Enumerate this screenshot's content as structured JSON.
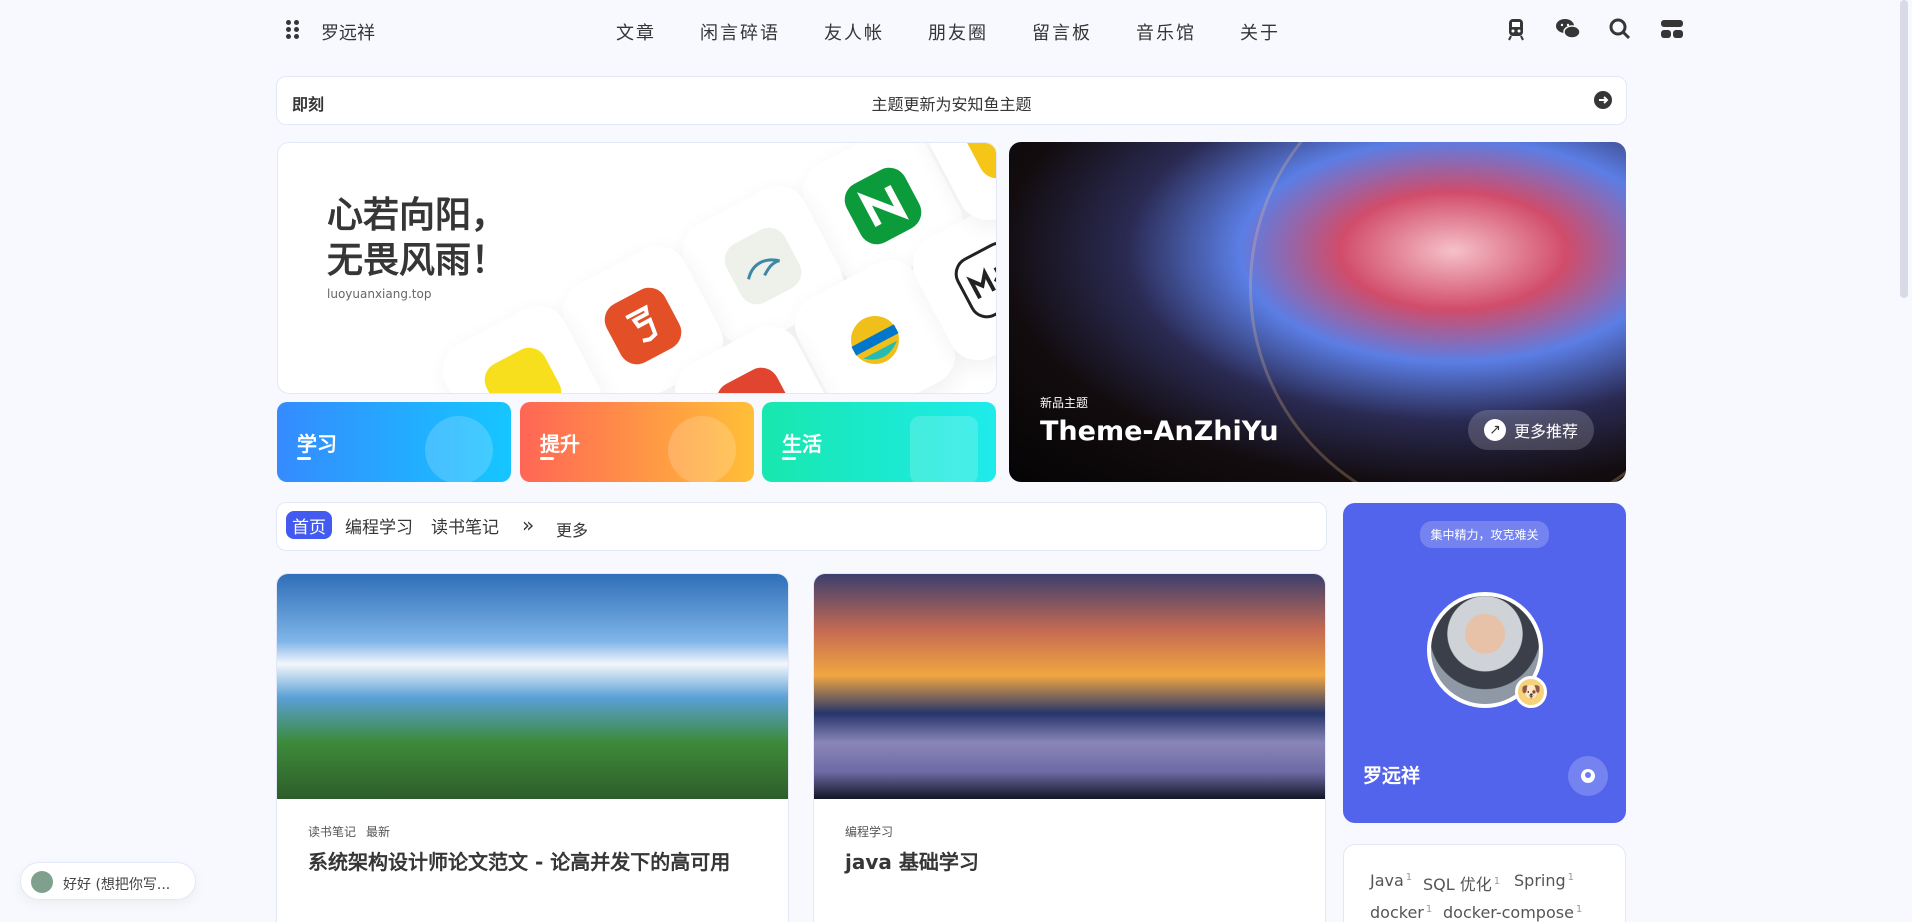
{
  "header": {
    "site_name": "罗远祥",
    "nav": [
      "文章",
      "闲言碎语",
      "友人帐",
      "朋友圈",
      "留言板",
      "音乐馆",
      "关于"
    ],
    "icons": [
      "train-icon",
      "wechat-icon",
      "search-icon",
      "switch-icon"
    ]
  },
  "notice": {
    "label": "即刻",
    "text": "主题更新为安知鱼主题"
  },
  "hero": {
    "title": "心若向阳，\n无畏风雨！",
    "url": "luoyuanxiang.top"
  },
  "categories": [
    {
      "label": "学习",
      "color_start": "#358bff",
      "color_end": "#15c6ff"
    },
    {
      "label": "提升",
      "color_start": "#f65",
      "color_end": "#ffbf37"
    },
    {
      "label": "生活",
      "color_start": "#18e7ae",
      "color_end": "#1eebeb"
    }
  ],
  "feature": {
    "badge": "新品主题",
    "title": "Theme-AnZhiYu",
    "more": "更多推荐"
  },
  "tabs": {
    "items": [
      "首页",
      "编程学习",
      "读书笔记"
    ],
    "more": "更多"
  },
  "posts": [
    {
      "tags": [
        "读书笔记",
        "最新"
      ],
      "title": "系统架构设计师论文范文 - 论高并发下的高可用"
    },
    {
      "tags": [
        "编程学习"
      ],
      "title": "java 基础学习"
    }
  ],
  "author": {
    "motto": "集中精力，攻克难关",
    "name": "罗远祥"
  },
  "tags": [
    {
      "name": "Java",
      "count": "1"
    },
    {
      "name": "SQL 优化",
      "count": "1"
    },
    {
      "name": "Spring",
      "count": "1"
    },
    {
      "name": "docker",
      "count": "1"
    },
    {
      "name": "docker-compose",
      "count": "1"
    }
  ],
  "music": {
    "text": "好好 (想把你写..."
  },
  "colors": {
    "accent": "#425aef",
    "author_card": "#5264ec",
    "background": "#f7f9fe"
  }
}
